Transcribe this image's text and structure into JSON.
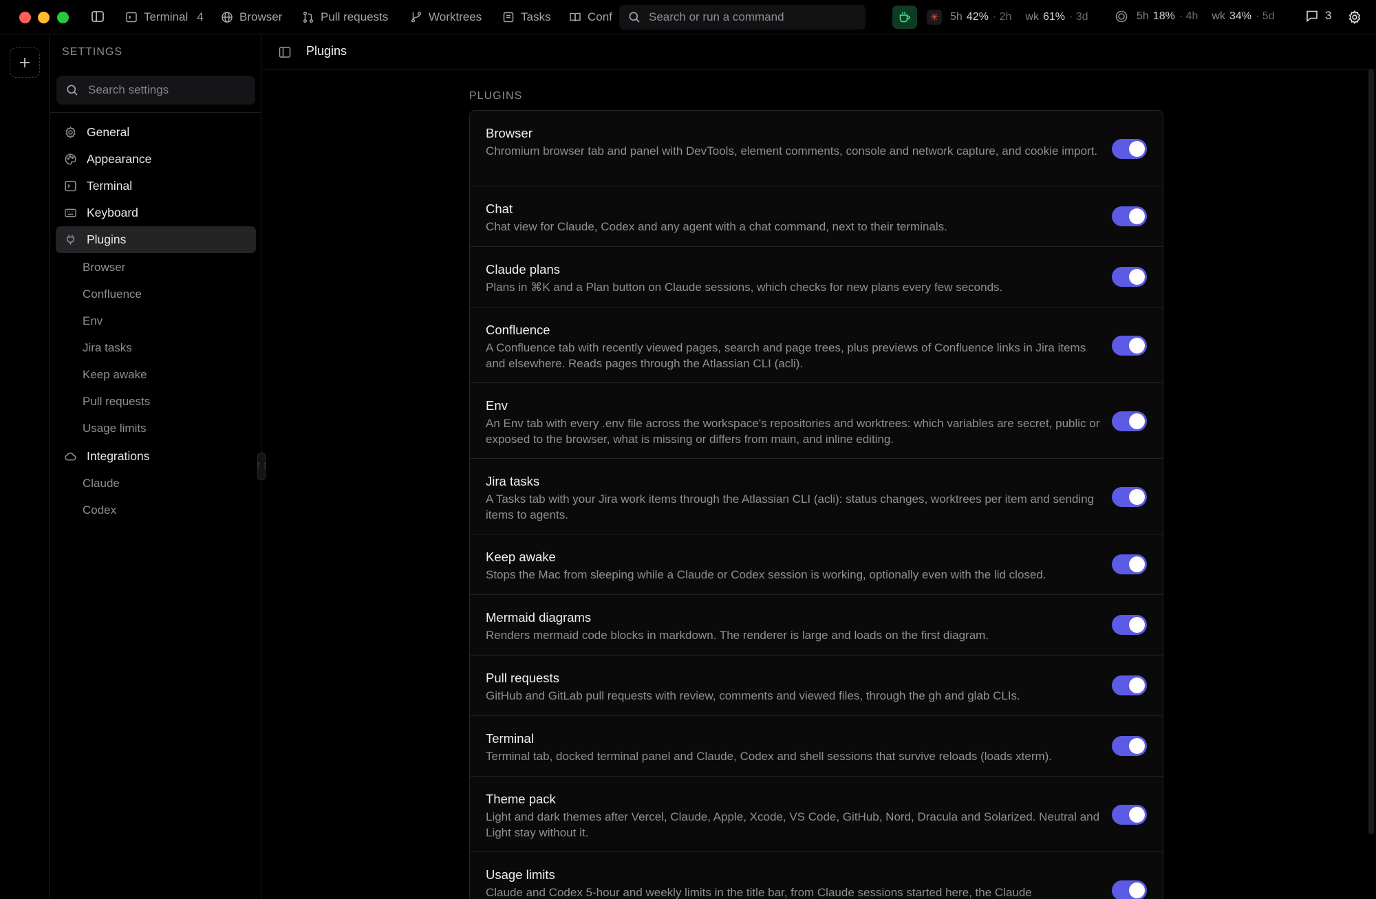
{
  "titlebar": {
    "tabs": [
      {
        "label": "Terminal",
        "count": "4",
        "icon": "terminal-icon"
      },
      {
        "label": "Browser",
        "icon": "globe-icon"
      },
      {
        "label": "Pull requests",
        "icon": "git-pull-request-icon"
      },
      {
        "label": "Worktrees",
        "icon": "git-branch-icon"
      },
      {
        "label": "Tasks",
        "icon": "tasks-icon"
      },
      {
        "label": "Conf",
        "icon": "book-icon"
      }
    ],
    "search_placeholder": "Search or run a command",
    "claude_usage": {
      "session_window": "5h",
      "session_pct": "42%",
      "session_reset": "· 2h",
      "week_window": "wk",
      "week_pct": "61%",
      "week_reset": "· 3d"
    },
    "codex_usage": {
      "session_window": "5h",
      "session_pct": "18%",
      "session_reset": "· 4h",
      "week_window": "wk",
      "week_pct": "34%",
      "week_reset": "· 5d"
    },
    "comments_count": "3"
  },
  "sidebar": {
    "heading": "SETTINGS",
    "search_placeholder": "Search settings",
    "items": [
      {
        "label": "General",
        "icon": "gear-icon"
      },
      {
        "label": "Appearance",
        "icon": "palette-icon"
      },
      {
        "label": "Terminal",
        "icon": "terminal-icon"
      },
      {
        "label": "Keyboard",
        "icon": "keyboard-icon"
      },
      {
        "label": "Plugins",
        "icon": "plug-icon",
        "active": true
      },
      {
        "label": "Integrations",
        "icon": "cloud-icon"
      }
    ],
    "plugin_subitems": [
      "Browser",
      "Confluence",
      "Env",
      "Jira tasks",
      "Keep awake",
      "Pull requests",
      "Usage limits"
    ],
    "integration_subitems": [
      "Claude",
      "Codex"
    ]
  },
  "main": {
    "title": "Plugins",
    "section_label": "PLUGINS",
    "plugins": [
      {
        "name": "Browser",
        "description": "Chromium browser tab and panel with DevTools, element comments, console and network capture, and cookie import.",
        "enabled": true
      },
      {
        "name": "Chat",
        "description": "Chat view for Claude, Codex and any agent with a chat command, next to their terminals.",
        "enabled": true
      },
      {
        "name": "Claude plans",
        "description": "Plans in ⌘K and a Plan button on Claude sessions, which checks for new plans every few seconds.",
        "enabled": true
      },
      {
        "name": "Confluence",
        "description": "A Confluence tab with recently viewed pages, search and page trees, plus previews of Confluence links in Jira items and elsewhere. Reads pages through the Atlassian CLI (acli).",
        "enabled": true
      },
      {
        "name": "Env",
        "description": "An Env tab with every .env file across the workspace's repositories and worktrees: which variables are secret, public or exposed to the browser, what is missing or differs from main, and inline editing.",
        "enabled": true
      },
      {
        "name": "Jira tasks",
        "description": "A Tasks tab with your Jira work items through the Atlassian CLI (acli): status changes, worktrees per item and sending items to agents.",
        "enabled": true
      },
      {
        "name": "Keep awake",
        "description": "Stops the Mac from sleeping while a Claude or Codex session is working, optionally even with the lid closed.",
        "enabled": true
      },
      {
        "name": "Mermaid diagrams",
        "description": "Renders mermaid code blocks in markdown. The renderer is large and loads on the first diagram.",
        "enabled": true
      },
      {
        "name": "Pull requests",
        "description": "GitHub and GitLab pull requests with review, comments and viewed files, through the gh and glab CLIs.",
        "enabled": true
      },
      {
        "name": "Terminal",
        "description": "Terminal tab, docked terminal panel and Claude, Codex and shell sessions that survive reloads (loads xterm).",
        "enabled": true
      },
      {
        "name": "Theme pack",
        "description": "Light and dark themes after Vercel, Claude, Apple, Xcode, VS Code, GitHub, Nord, Dracula and Solarized. Neutral and Light stay without it.",
        "enabled": true
      },
      {
        "name": "Usage limits",
        "description": "Claude and Codex 5-hour and weekly limits in the title bar, from Claude sessions started here, the Claude",
        "enabled": true
      }
    ]
  },
  "colors": {
    "accent": "#5b5be6",
    "background": "#000000",
    "active_nav": "#242427",
    "usage_button": "#0f3a24"
  }
}
